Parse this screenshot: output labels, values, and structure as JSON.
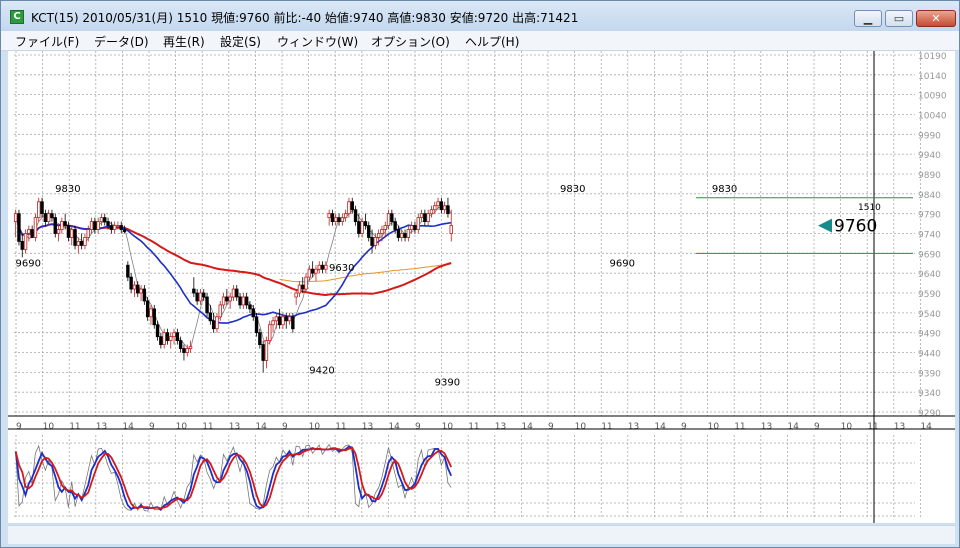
{
  "window": {
    "title": "KCT(15) 2010/05/31(月) 1510 現値:9760 前比:-40 始値:9740 高値:9830 安値:9720 出高:71421",
    "app_icon_letter": "C",
    "minimize_glyph": "▁",
    "maximize_glyph": "▭",
    "close_glyph": "✕"
  },
  "menu": [
    {
      "label": "ファイル(F)"
    },
    {
      "label": "データ(D)"
    },
    {
      "label": "再生(R)"
    },
    {
      "label": "設定(S)"
    },
    {
      "label": "ウィンドウ(W)"
    },
    {
      "label": "オプション(O)"
    },
    {
      "label": "ヘルプ(H)"
    }
  ],
  "colors": {
    "up": "#c02020",
    "down": "#000000",
    "ma_short": "#1d2fc8",
    "ma_mid": "#d61818",
    "ma_long": "#e3962a",
    "ma_price": "#808080",
    "hline": "#1f9a2a",
    "marker": "#1a8a8a",
    "grid": "#a9a9a9"
  },
  "chart_data": {
    "type": "candlestick",
    "y_ticks": [
      10190,
      10140,
      10090,
      10040,
      9990,
      9940,
      9890,
      9840,
      9790,
      9740,
      9690,
      9640,
      9590,
      9540,
      9490,
      9440,
      9390,
      9340,
      9290
    ],
    "ylim": [
      9280,
      10200
    ],
    "x_ticks": [
      "9",
      "10",
      "11",
      "13",
      "14",
      "9",
      "10",
      "11",
      "13",
      "14",
      "9",
      "10",
      "11",
      "13",
      "14",
      "9",
      "10",
      "11",
      "13",
      "14",
      "9",
      "10",
      "11",
      "13",
      "14",
      "9",
      "10",
      "11",
      "13",
      "14",
      "9",
      "10",
      "11",
      "13",
      "14"
    ],
    "last_price": "9760",
    "current_time": "1510",
    "horizontal_lines": [
      9830,
      9690
    ],
    "price_annotations": [
      {
        "text": "9830",
        "price": 9830,
        "bar": 15
      },
      {
        "text": "9690",
        "price": 9690,
        "bar": 3
      },
      {
        "text": "9630",
        "price": 9630,
        "bar": 98
      },
      {
        "text": "9420",
        "price": 9420,
        "bar": 92
      },
      {
        "text": "9390",
        "price": 9390,
        "bar": 130
      },
      {
        "text": "9830",
        "price": 9830,
        "bar": 168
      },
      {
        "text": "9690",
        "price": 9690,
        "bar": 183
      },
      {
        "text": "9830",
        "price": 9830,
        "bar": 214
      }
    ],
    "candles": [
      [
        9770,
        9800,
        9730,
        9790
      ],
      [
        9790,
        9800,
        9710,
        9720
      ],
      [
        9720,
        9740,
        9680,
        9700
      ],
      [
        9700,
        9750,
        9690,
        9740
      ],
      [
        9740,
        9760,
        9720,
        9750
      ],
      [
        9750,
        9760,
        9730,
        9730
      ],
      [
        9730,
        9790,
        9720,
        9780
      ],
      [
        9780,
        9830,
        9770,
        9820
      ],
      [
        9820,
        9830,
        9780,
        9790
      ],
      [
        9790,
        9800,
        9760,
        9770
      ],
      [
        9770,
        9800,
        9760,
        9790
      ],
      [
        9790,
        9800,
        9770,
        9780
      ],
      [
        9780,
        9790,
        9730,
        9740
      ],
      [
        9740,
        9760,
        9720,
        9750
      ],
      [
        9750,
        9780,
        9740,
        9770
      ],
      [
        9770,
        9790,
        9750,
        9760
      ],
      [
        9760,
        9770,
        9720,
        9730
      ],
      [
        9730,
        9760,
        9710,
        9750
      ],
      [
        9750,
        9760,
        9700,
        9710
      ],
      [
        9710,
        9730,
        9690,
        9720
      ],
      [
        9720,
        9740,
        9700,
        9710
      ],
      [
        9710,
        9740,
        9700,
        9730
      ],
      [
        9730,
        9760,
        9720,
        9750
      ],
      [
        9750,
        9780,
        9740,
        9770
      ],
      [
        9770,
        9780,
        9740,
        9750
      ],
      [
        9750,
        9780,
        9740,
        9770
      ],
      [
        9770,
        9790,
        9760,
        9780
      ],
      [
        9780,
        9790,
        9760,
        9770
      ],
      [
        9770,
        9780,
        9750,
        9760
      ],
      [
        9760,
        9770,
        9740,
        9750
      ],
      [
        9750,
        9770,
        9740,
        9760
      ],
      [
        9760,
        9770,
        9750,
        9760
      ],
      [
        9760,
        9770,
        9740,
        9750
      ],
      [
        9750,
        9760,
        9740,
        9745
      ],
      [
        9660,
        9670,
        9620,
        9630
      ],
      [
        9630,
        9640,
        9590,
        9600
      ],
      [
        9600,
        9620,
        9580,
        9610
      ],
      [
        9610,
        9620,
        9580,
        9590
      ],
      [
        9590,
        9610,
        9570,
        9600
      ],
      [
        9600,
        9610,
        9560,
        9570
      ],
      [
        9570,
        9580,
        9520,
        9530
      ],
      [
        9530,
        9560,
        9510,
        9550
      ],
      [
        9550,
        9560,
        9500,
        9510
      ],
      [
        9510,
        9520,
        9470,
        9480
      ],
      [
        9480,
        9490,
        9450,
        9460
      ],
      [
        9460,
        9500,
        9450,
        9490
      ],
      [
        9490,
        9500,
        9460,
        9470
      ],
      [
        9470,
        9490,
        9450,
        9480
      ],
      [
        9480,
        9500,
        9460,
        9490
      ],
      [
        9490,
        9500,
        9460,
        9470
      ],
      [
        9470,
        9480,
        9440,
        9450
      ],
      [
        9450,
        9460,
        9420,
        9440
      ],
      [
        9440,
        9460,
        9430,
        9450
      ],
      [
        9450,
        9470,
        9440,
        9455
      ],
      [
        9600,
        9630,
        9580,
        9590
      ],
      [
        9590,
        9600,
        9560,
        9570
      ],
      [
        9570,
        9600,
        9560,
        9590
      ],
      [
        9590,
        9600,
        9570,
        9580
      ],
      [
        9580,
        9590,
        9530,
        9540
      ],
      [
        9540,
        9560,
        9510,
        9520
      ],
      [
        9520,
        9540,
        9490,
        9500
      ],
      [
        9500,
        9540,
        9490,
        9530
      ],
      [
        9530,
        9570,
        9520,
        9560
      ],
      [
        9560,
        9590,
        9550,
        9580
      ],
      [
        9580,
        9600,
        9560,
        9570
      ],
      [
        9570,
        9590,
        9550,
        9580
      ],
      [
        9580,
        9610,
        9570,
        9600
      ],
      [
        9600,
        9610,
        9570,
        9580
      ],
      [
        9580,
        9590,
        9550,
        9560
      ],
      [
        9560,
        9590,
        9550,
        9580
      ],
      [
        9580,
        9590,
        9550,
        9560
      ],
      [
        9560,
        9570,
        9540,
        9550
      ],
      [
        9550,
        9560,
        9520,
        9530
      ],
      [
        9530,
        9540,
        9480,
        9490
      ],
      [
        9490,
        9500,
        9450,
        9460
      ],
      [
        9460,
        9470,
        9390,
        9420
      ],
      [
        9420,
        9480,
        9400,
        9470
      ],
      [
        9470,
        9520,
        9460,
        9510
      ],
      [
        9510,
        9530,
        9490,
        9520
      ],
      [
        9520,
        9540,
        9500,
        9530
      ],
      [
        9530,
        9550,
        9500,
        9510
      ],
      [
        9510,
        9540,
        9500,
        9530
      ],
      [
        9530,
        9540,
        9500,
        9520
      ],
      [
        9520,
        9540,
        9510,
        9530
      ],
      [
        9530,
        9540,
        9490,
        9500
      ],
      [
        9580,
        9600,
        9560,
        9590
      ],
      [
        9590,
        9620,
        9580,
        9610
      ],
      [
        9610,
        9630,
        9590,
        9600
      ],
      [
        9600,
        9640,
        9590,
        9630
      ],
      [
        9630,
        9660,
        9620,
        9650
      ],
      [
        9650,
        9670,
        9630,
        9640
      ],
      [
        9640,
        9660,
        9620,
        9650
      ],
      [
        9650,
        9670,
        9640,
        9660
      ],
      [
        9660,
        9670,
        9640,
        9650
      ],
      [
        9650,
        9670,
        9640,
        9660
      ],
      [
        9780,
        9800,
        9760,
        9790
      ],
      [
        9790,
        9800,
        9760,
        9770
      ],
      [
        9770,
        9790,
        9760,
        9780
      ],
      [
        9780,
        9790,
        9760,
        9770
      ],
      [
        9770,
        9790,
        9760,
        9780
      ],
      [
        9780,
        9800,
        9770,
        9790
      ],
      [
        9790,
        9830,
        9780,
        9820
      ],
      [
        9820,
        9830,
        9790,
        9800
      ],
      [
        9800,
        9810,
        9760,
        9770
      ],
      [
        9770,
        9790,
        9730,
        9740
      ],
      [
        9740,
        9780,
        9730,
        9770
      ],
      [
        9770,
        9790,
        9750,
        9760
      ],
      [
        9760,
        9770,
        9720,
        9730
      ],
      [
        9730,
        9750,
        9690,
        9710
      ],
      [
        9710,
        9740,
        9700,
        9730
      ],
      [
        9730,
        9750,
        9710,
        9740
      ],
      [
        9740,
        9760,
        9720,
        9750
      ],
      [
        9750,
        9770,
        9730,
        9760
      ],
      [
        9760,
        9800,
        9750,
        9790
      ],
      [
        9790,
        9800,
        9760,
        9770
      ],
      [
        9770,
        9780,
        9740,
        9750
      ],
      [
        9750,
        9760,
        9720,
        9730
      ],
      [
        9730,
        9750,
        9720,
        9740
      ],
      [
        9740,
        9750,
        9720,
        9730
      ],
      [
        9730,
        9760,
        9720,
        9750
      ],
      [
        9750,
        9770,
        9740,
        9760
      ],
      [
        9760,
        9770,
        9740,
        9750
      ],
      [
        9750,
        9790,
        9740,
        9780
      ],
      [
        9780,
        9800,
        9770,
        9790
      ],
      [
        9790,
        9800,
        9760,
        9770
      ],
      [
        9770,
        9800,
        9760,
        9790
      ],
      [
        9790,
        9810,
        9780,
        9800
      ],
      [
        9800,
        9820,
        9790,
        9810
      ],
      [
        9810,
        9830,
        9800,
        9820
      ],
      [
        9820,
        9830,
        9790,
        9800
      ],
      [
        9800,
        9820,
        9790,
        9810
      ],
      [
        9810,
        9830,
        9780,
        9790
      ],
      [
        9740,
        9800,
        9720,
        9760
      ]
    ]
  }
}
